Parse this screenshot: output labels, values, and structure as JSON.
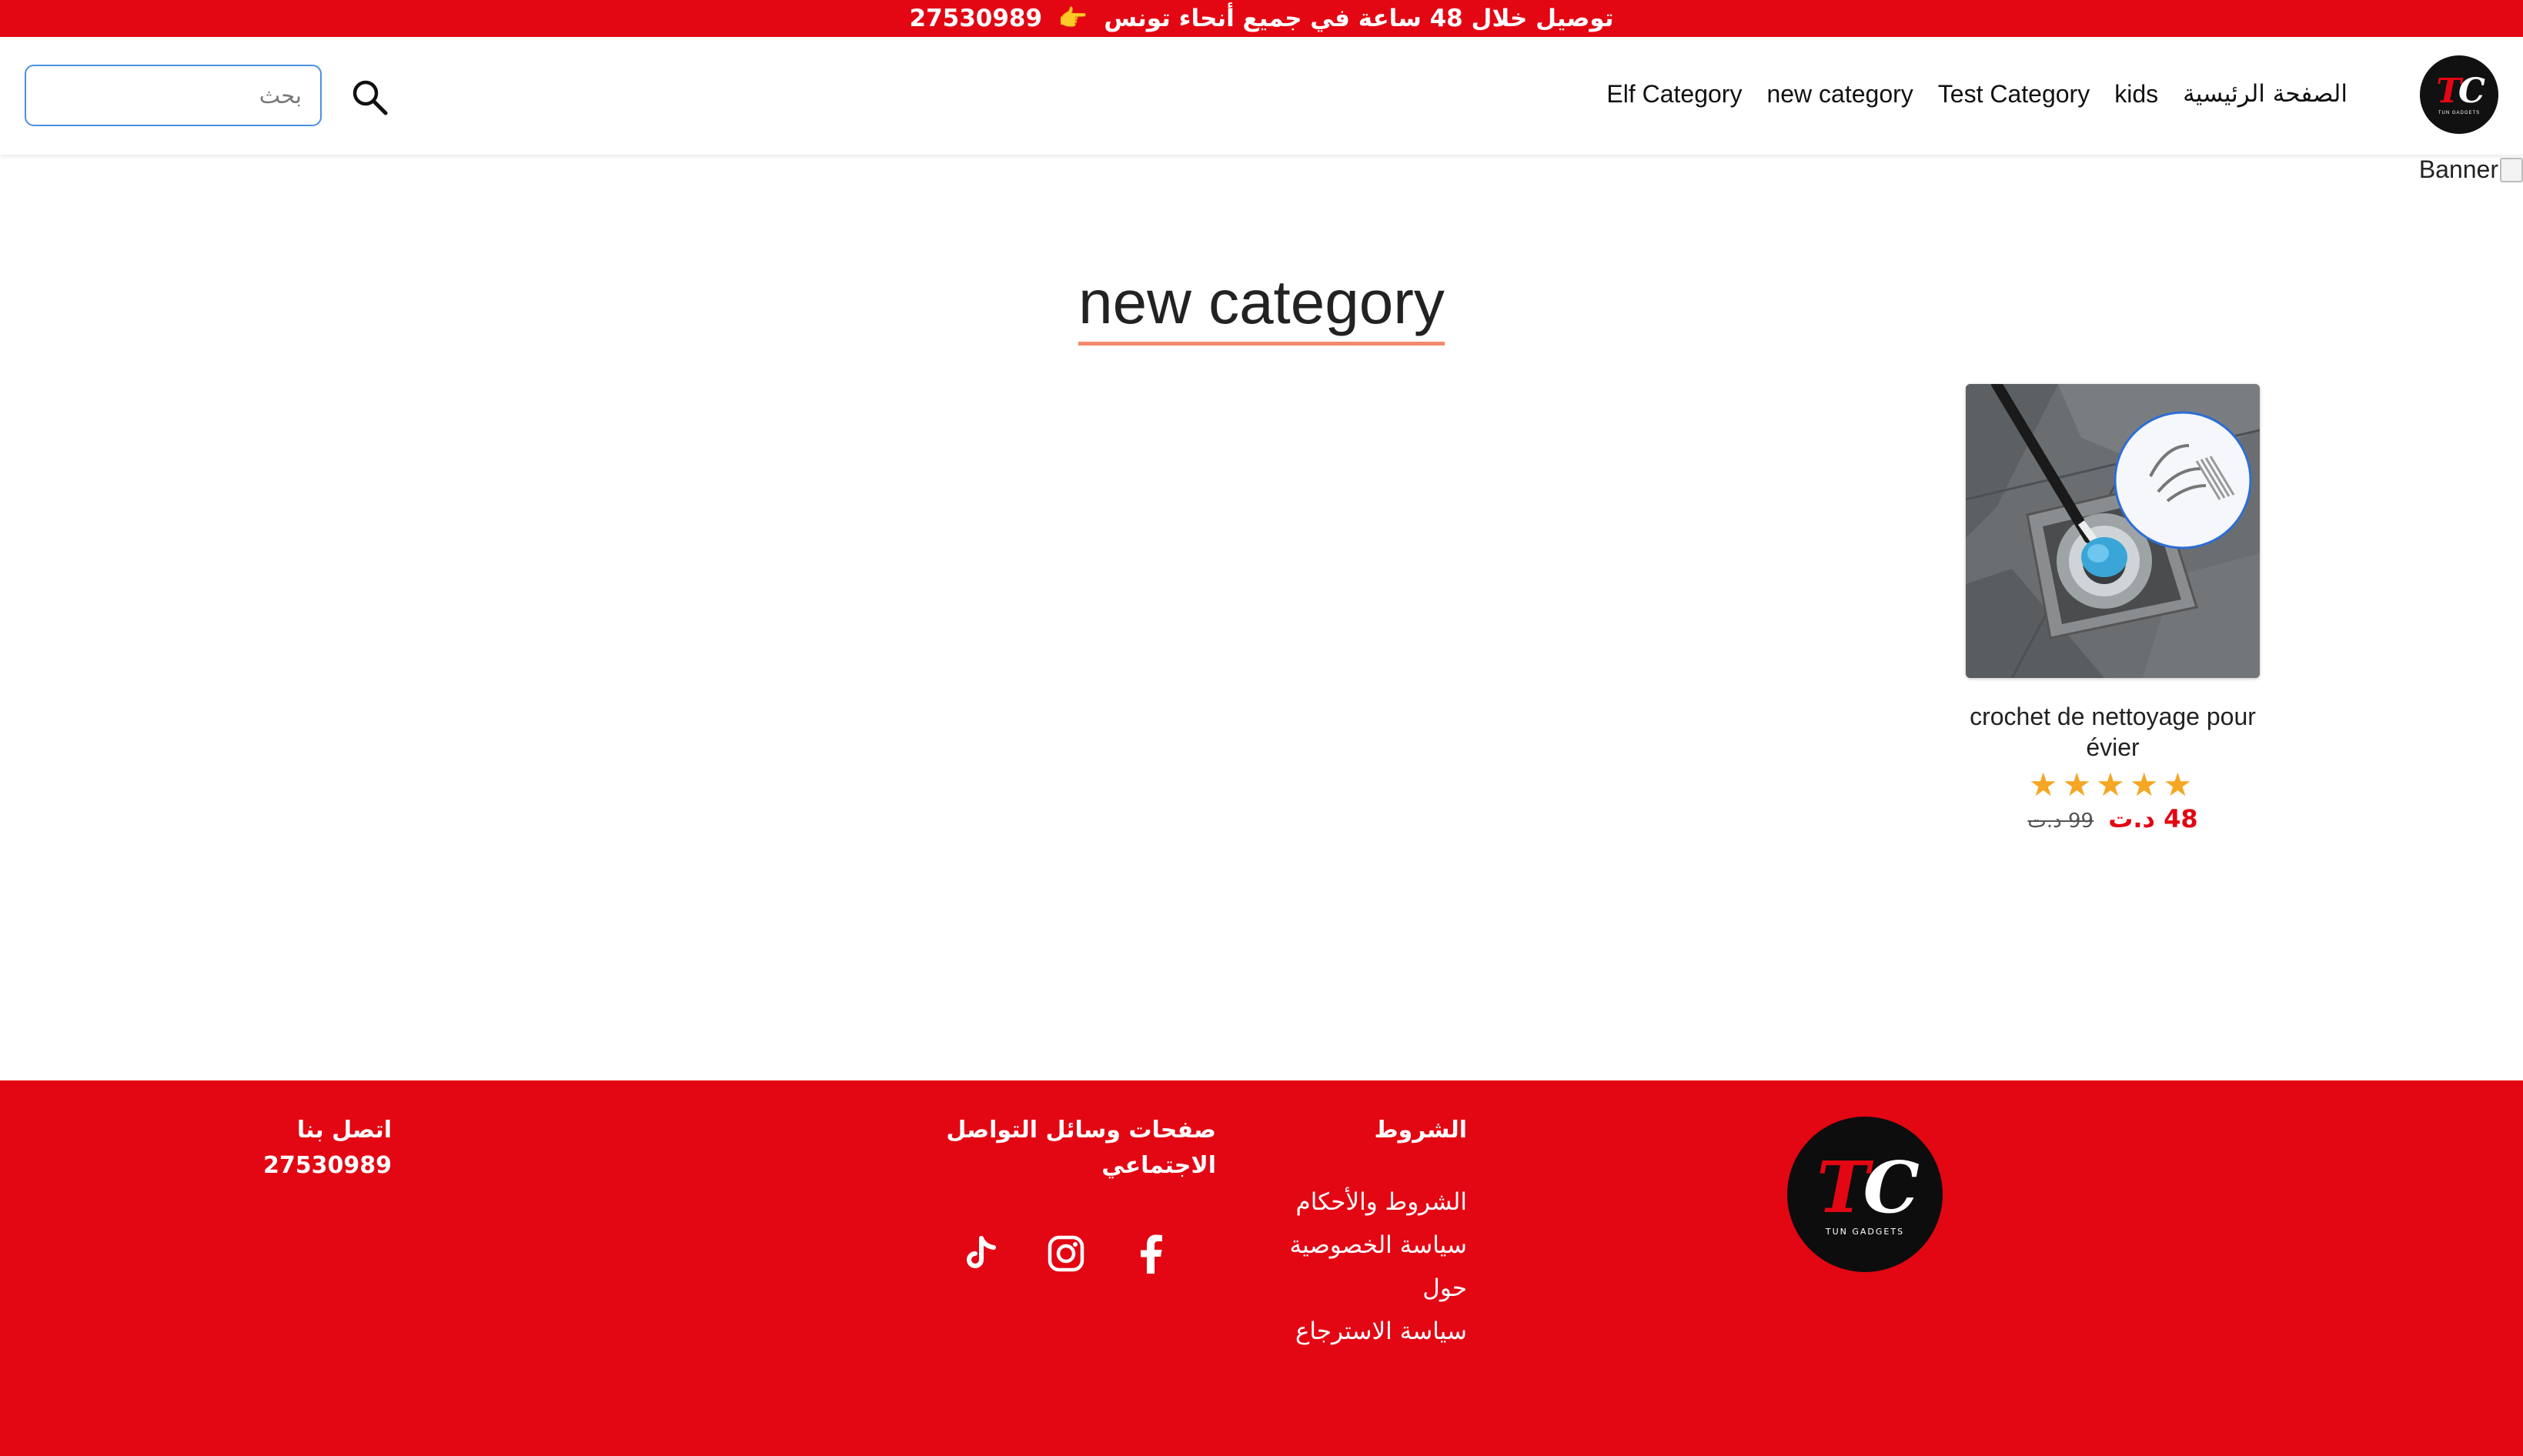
{
  "announcement": {
    "text": "توصيل خلال 48 ساعة في جميع أنحاء تونس",
    "emoji": "👉",
    "phone": "27530989"
  },
  "brand": {
    "logo_letters_t": "T",
    "logo_letters_c": "C",
    "logo_subtitle": "TUN GADGETS",
    "primary_color": "#e30613"
  },
  "nav": {
    "items": [
      {
        "label": "الصفحة الرئيسية"
      },
      {
        "label": "kids"
      },
      {
        "label": "Test Category"
      },
      {
        "label": "new category"
      },
      {
        "label": "Elf Category"
      }
    ]
  },
  "search": {
    "placeholder": "بحث",
    "value": ""
  },
  "banner": {
    "alt_text": "Banner"
  },
  "page": {
    "title": "new category"
  },
  "products": [
    {
      "name": "crochet de nettoyage pour évier",
      "rating": 5,
      "stars": "★★★★★",
      "price": "48 د.ت",
      "old_price": "99 د.ت"
    }
  ],
  "footer": {
    "terms_title": "الشروط",
    "terms_links": [
      {
        "label": "الشروط والأحكام"
      },
      {
        "label": "سياسة الخصوصية"
      },
      {
        "label": "حول"
      },
      {
        "label": "سياسة الاسترجاع"
      }
    ],
    "social_title": "صفحات وسائل التواصل الاجتماعي",
    "social_icons": [
      "tiktok-icon",
      "instagram-icon",
      "facebook-icon"
    ],
    "contact_title": "اتصل بنا",
    "contact_phone": "27530989"
  }
}
